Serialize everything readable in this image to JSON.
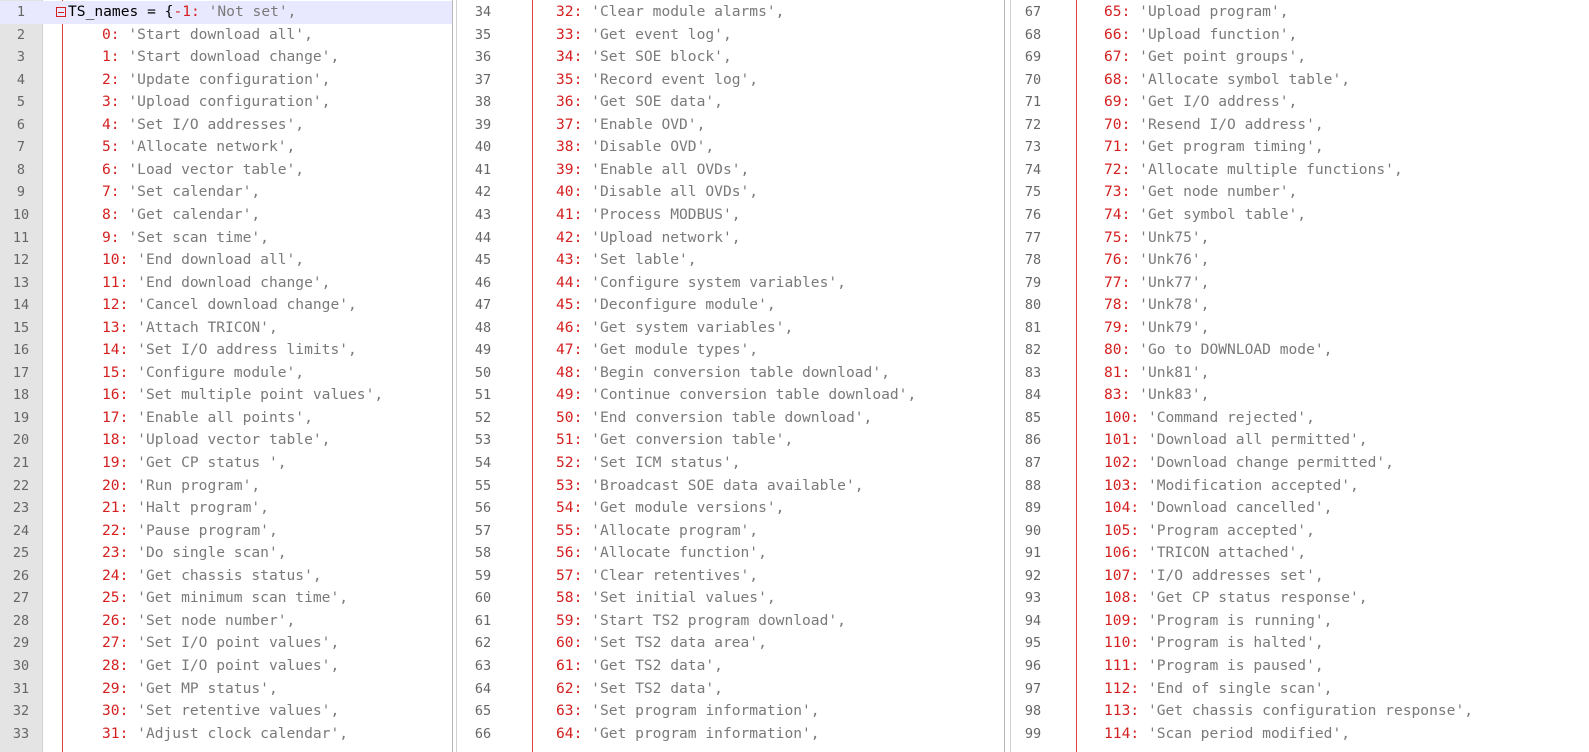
{
  "panes": [
    {
      "lines": [
        {
          "n": "1",
          "header": true,
          "name": "TS_names",
          "open": " = {",
          "key": "-1",
          "val": "'Not set',"
        },
        {
          "n": "2",
          "key": "0",
          "val": "'Start download all',"
        },
        {
          "n": "3",
          "key": "1",
          "val": "'Start download change',"
        },
        {
          "n": "4",
          "key": "2",
          "val": "'Update configuration',"
        },
        {
          "n": "5",
          "key": "3",
          "val": "'Upload configuration',"
        },
        {
          "n": "6",
          "key": "4",
          "val": "'Set I/O addresses',"
        },
        {
          "n": "7",
          "key": "5",
          "val": "'Allocate network',"
        },
        {
          "n": "8",
          "key": "6",
          "val": "'Load vector table',"
        },
        {
          "n": "9",
          "key": "7",
          "val": "'Set calendar',"
        },
        {
          "n": "10",
          "key": "8",
          "val": "'Get calendar',"
        },
        {
          "n": "11",
          "key": "9",
          "val": "'Set scan time',"
        },
        {
          "n": "12",
          "key": "10",
          "val": "'End download all',"
        },
        {
          "n": "13",
          "key": "11",
          "val": "'End download change',"
        },
        {
          "n": "14",
          "key": "12",
          "val": "'Cancel download change',"
        },
        {
          "n": "15",
          "key": "13",
          "val": "'Attach TRICON',"
        },
        {
          "n": "16",
          "key": "14",
          "val": "'Set I/O address limits',"
        },
        {
          "n": "17",
          "key": "15",
          "val": "'Configure module',"
        },
        {
          "n": "18",
          "key": "16",
          "val": "'Set multiple point values',"
        },
        {
          "n": "19",
          "key": "17",
          "val": "'Enable all points',"
        },
        {
          "n": "20",
          "key": "18",
          "val": "'Upload vector table',"
        },
        {
          "n": "21",
          "key": "19",
          "val": "'Get CP status ',"
        },
        {
          "n": "22",
          "key": "20",
          "val": "'Run program',"
        },
        {
          "n": "23",
          "key": "21",
          "val": "'Halt program',"
        },
        {
          "n": "24",
          "key": "22",
          "val": "'Pause program',"
        },
        {
          "n": "25",
          "key": "23",
          "val": "'Do single scan',"
        },
        {
          "n": "26",
          "key": "24",
          "val": "'Get chassis status',"
        },
        {
          "n": "27",
          "key": "25",
          "val": "'Get minimum scan time',"
        },
        {
          "n": "28",
          "key": "26",
          "val": "'Set node number',"
        },
        {
          "n": "29",
          "key": "27",
          "val": "'Set I/O point values',"
        },
        {
          "n": "30",
          "key": "28",
          "val": "'Get I/O point values',"
        },
        {
          "n": "31",
          "key": "29",
          "val": "'Get MP status',"
        },
        {
          "n": "32",
          "key": "30",
          "val": "'Set retentive values',"
        },
        {
          "n": "33",
          "key": "31",
          "val": "'Adjust clock calendar',"
        }
      ]
    },
    {
      "lines": [
        {
          "n": "34",
          "key": "32",
          "val": "'Clear module alarms',"
        },
        {
          "n": "35",
          "key": "33",
          "val": "'Get event log',"
        },
        {
          "n": "36",
          "key": "34",
          "val": "'Set SOE block',"
        },
        {
          "n": "37",
          "key": "35",
          "val": "'Record event log',"
        },
        {
          "n": "38",
          "key": "36",
          "val": "'Get SOE data',"
        },
        {
          "n": "39",
          "key": "37",
          "val": "'Enable OVD',"
        },
        {
          "n": "40",
          "key": "38",
          "val": "'Disable OVD',"
        },
        {
          "n": "41",
          "key": "39",
          "val": "'Enable all OVDs',"
        },
        {
          "n": "42",
          "key": "40",
          "val": "'Disable all OVDs',"
        },
        {
          "n": "43",
          "key": "41",
          "val": "'Process MODBUS',"
        },
        {
          "n": "44",
          "key": "42",
          "val": "'Upload network',"
        },
        {
          "n": "45",
          "key": "43",
          "val": "'Set lable',"
        },
        {
          "n": "46",
          "key": "44",
          "val": "'Configure system variables',"
        },
        {
          "n": "47",
          "key": "45",
          "val": "'Deconfigure module',"
        },
        {
          "n": "48",
          "key": "46",
          "val": "'Get system variables',"
        },
        {
          "n": "49",
          "key": "47",
          "val": "'Get module types',"
        },
        {
          "n": "50",
          "key": "48",
          "val": "'Begin conversion table download',"
        },
        {
          "n": "51",
          "key": "49",
          "val": "'Continue conversion table download',"
        },
        {
          "n": "52",
          "key": "50",
          "val": "'End conversion table download',"
        },
        {
          "n": "53",
          "key": "51",
          "val": "'Get conversion table',"
        },
        {
          "n": "54",
          "key": "52",
          "val": "'Set ICM status',"
        },
        {
          "n": "55",
          "key": "53",
          "val": "'Broadcast SOE data available',"
        },
        {
          "n": "56",
          "key": "54",
          "val": "'Get module versions',"
        },
        {
          "n": "57",
          "key": "55",
          "val": "'Allocate program',"
        },
        {
          "n": "58",
          "key": "56",
          "val": "'Allocate function',"
        },
        {
          "n": "59",
          "key": "57",
          "val": "'Clear retentives',"
        },
        {
          "n": "60",
          "key": "58",
          "val": "'Set initial values',"
        },
        {
          "n": "61",
          "key": "59",
          "val": "'Start TS2 program download',"
        },
        {
          "n": "62",
          "key": "60",
          "val": "'Set TS2 data area',"
        },
        {
          "n": "63",
          "key": "61",
          "val": "'Get TS2 data',"
        },
        {
          "n": "64",
          "key": "62",
          "val": "'Set TS2 data',"
        },
        {
          "n": "65",
          "key": "63",
          "val": "'Set program information',"
        },
        {
          "n": "66",
          "key": "64",
          "val": "'Get program information',"
        }
      ]
    },
    {
      "lines": [
        {
          "n": "67",
          "key": "65",
          "val": "'Upload program',"
        },
        {
          "n": "68",
          "key": "66",
          "val": "'Upload function',"
        },
        {
          "n": "69",
          "key": "67",
          "val": "'Get point groups',"
        },
        {
          "n": "70",
          "key": "68",
          "val": "'Allocate symbol table',"
        },
        {
          "n": "71",
          "key": "69",
          "val": "'Get I/O address',"
        },
        {
          "n": "72",
          "key": "70",
          "val": "'Resend I/O address',"
        },
        {
          "n": "73",
          "key": "71",
          "val": "'Get program timing',"
        },
        {
          "n": "74",
          "key": "72",
          "val": "'Allocate multiple functions',"
        },
        {
          "n": "75",
          "key": "73",
          "val": "'Get node number',"
        },
        {
          "n": "76",
          "key": "74",
          "val": "'Get symbol table',"
        },
        {
          "n": "77",
          "key": "75",
          "val": "'Unk75',"
        },
        {
          "n": "78",
          "key": "76",
          "val": "'Unk76',"
        },
        {
          "n": "79",
          "key": "77",
          "val": "'Unk77',"
        },
        {
          "n": "80",
          "key": "78",
          "val": "'Unk78',"
        },
        {
          "n": "81",
          "key": "79",
          "val": "'Unk79',"
        },
        {
          "n": "82",
          "key": "80",
          "val": "'Go to DOWNLOAD mode',"
        },
        {
          "n": "83",
          "key": "81",
          "val": "'Unk81',"
        },
        {
          "n": "84",
          "key": "83",
          "val": "'Unk83',"
        },
        {
          "n": "85",
          "key": "100",
          "val": "'Command rejected',"
        },
        {
          "n": "86",
          "key": "101",
          "val": "'Download all permitted',"
        },
        {
          "n": "87",
          "key": "102",
          "val": "'Download change permitted',"
        },
        {
          "n": "88",
          "key": "103",
          "val": "'Modification accepted',"
        },
        {
          "n": "89",
          "key": "104",
          "val": "'Download cancelled',"
        },
        {
          "n": "90",
          "key": "105",
          "val": "'Program accepted',"
        },
        {
          "n": "91",
          "key": "106",
          "val": "'TRICON attached',"
        },
        {
          "n": "92",
          "key": "107",
          "val": "'I/O addresses set',"
        },
        {
          "n": "93",
          "key": "108",
          "val": "'Get CP status response',"
        },
        {
          "n": "94",
          "key": "109",
          "val": "'Program is running',"
        },
        {
          "n": "95",
          "key": "110",
          "val": "'Program is halted',"
        },
        {
          "n": "96",
          "key": "111",
          "val": "'Program is paused',"
        },
        {
          "n": "97",
          "key": "112",
          "val": "'End of single scan',"
        },
        {
          "n": "98",
          "key": "113",
          "val": "'Get chassis configuration response',"
        },
        {
          "n": "99",
          "key": "114",
          "val": "'Scan period modified',"
        }
      ]
    }
  ]
}
